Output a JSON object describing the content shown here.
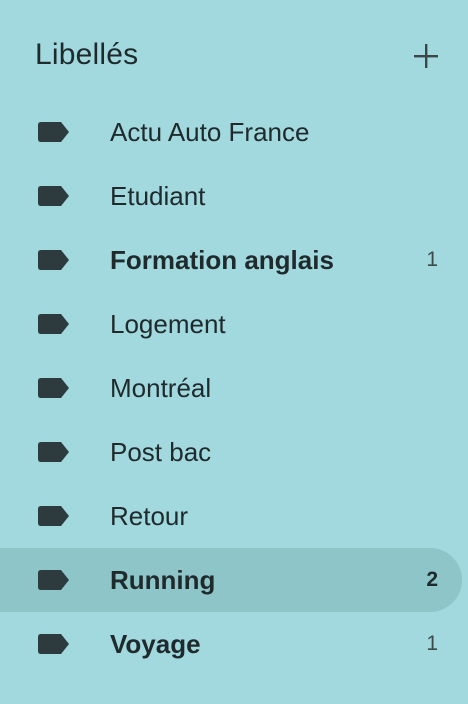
{
  "header": {
    "title": "Libellés",
    "add_icon": "plus-icon"
  },
  "labels": [
    {
      "name": "Actu Auto France",
      "count": "",
      "bold": false,
      "selected": false
    },
    {
      "name": "Etudiant",
      "count": "",
      "bold": false,
      "selected": false
    },
    {
      "name": "Formation anglais",
      "count": "1",
      "bold": true,
      "selected": false
    },
    {
      "name": "Logement",
      "count": "",
      "bold": false,
      "selected": false
    },
    {
      "name": "Montréal",
      "count": "",
      "bold": false,
      "selected": false
    },
    {
      "name": "Post bac",
      "count": "",
      "bold": false,
      "selected": false
    },
    {
      "name": "Retour",
      "count": "",
      "bold": false,
      "selected": false
    },
    {
      "name": "Running",
      "count": "2",
      "bold": true,
      "selected": true
    },
    {
      "name": "Voyage",
      "count": "1",
      "bold": true,
      "selected": false
    }
  ],
  "label_icon": "label-tag-icon",
  "colors": {
    "background": "#a1d9de",
    "selected_row": "#8ec5c9",
    "icon": "#2e3b3e",
    "text": "#1f2a2c"
  }
}
